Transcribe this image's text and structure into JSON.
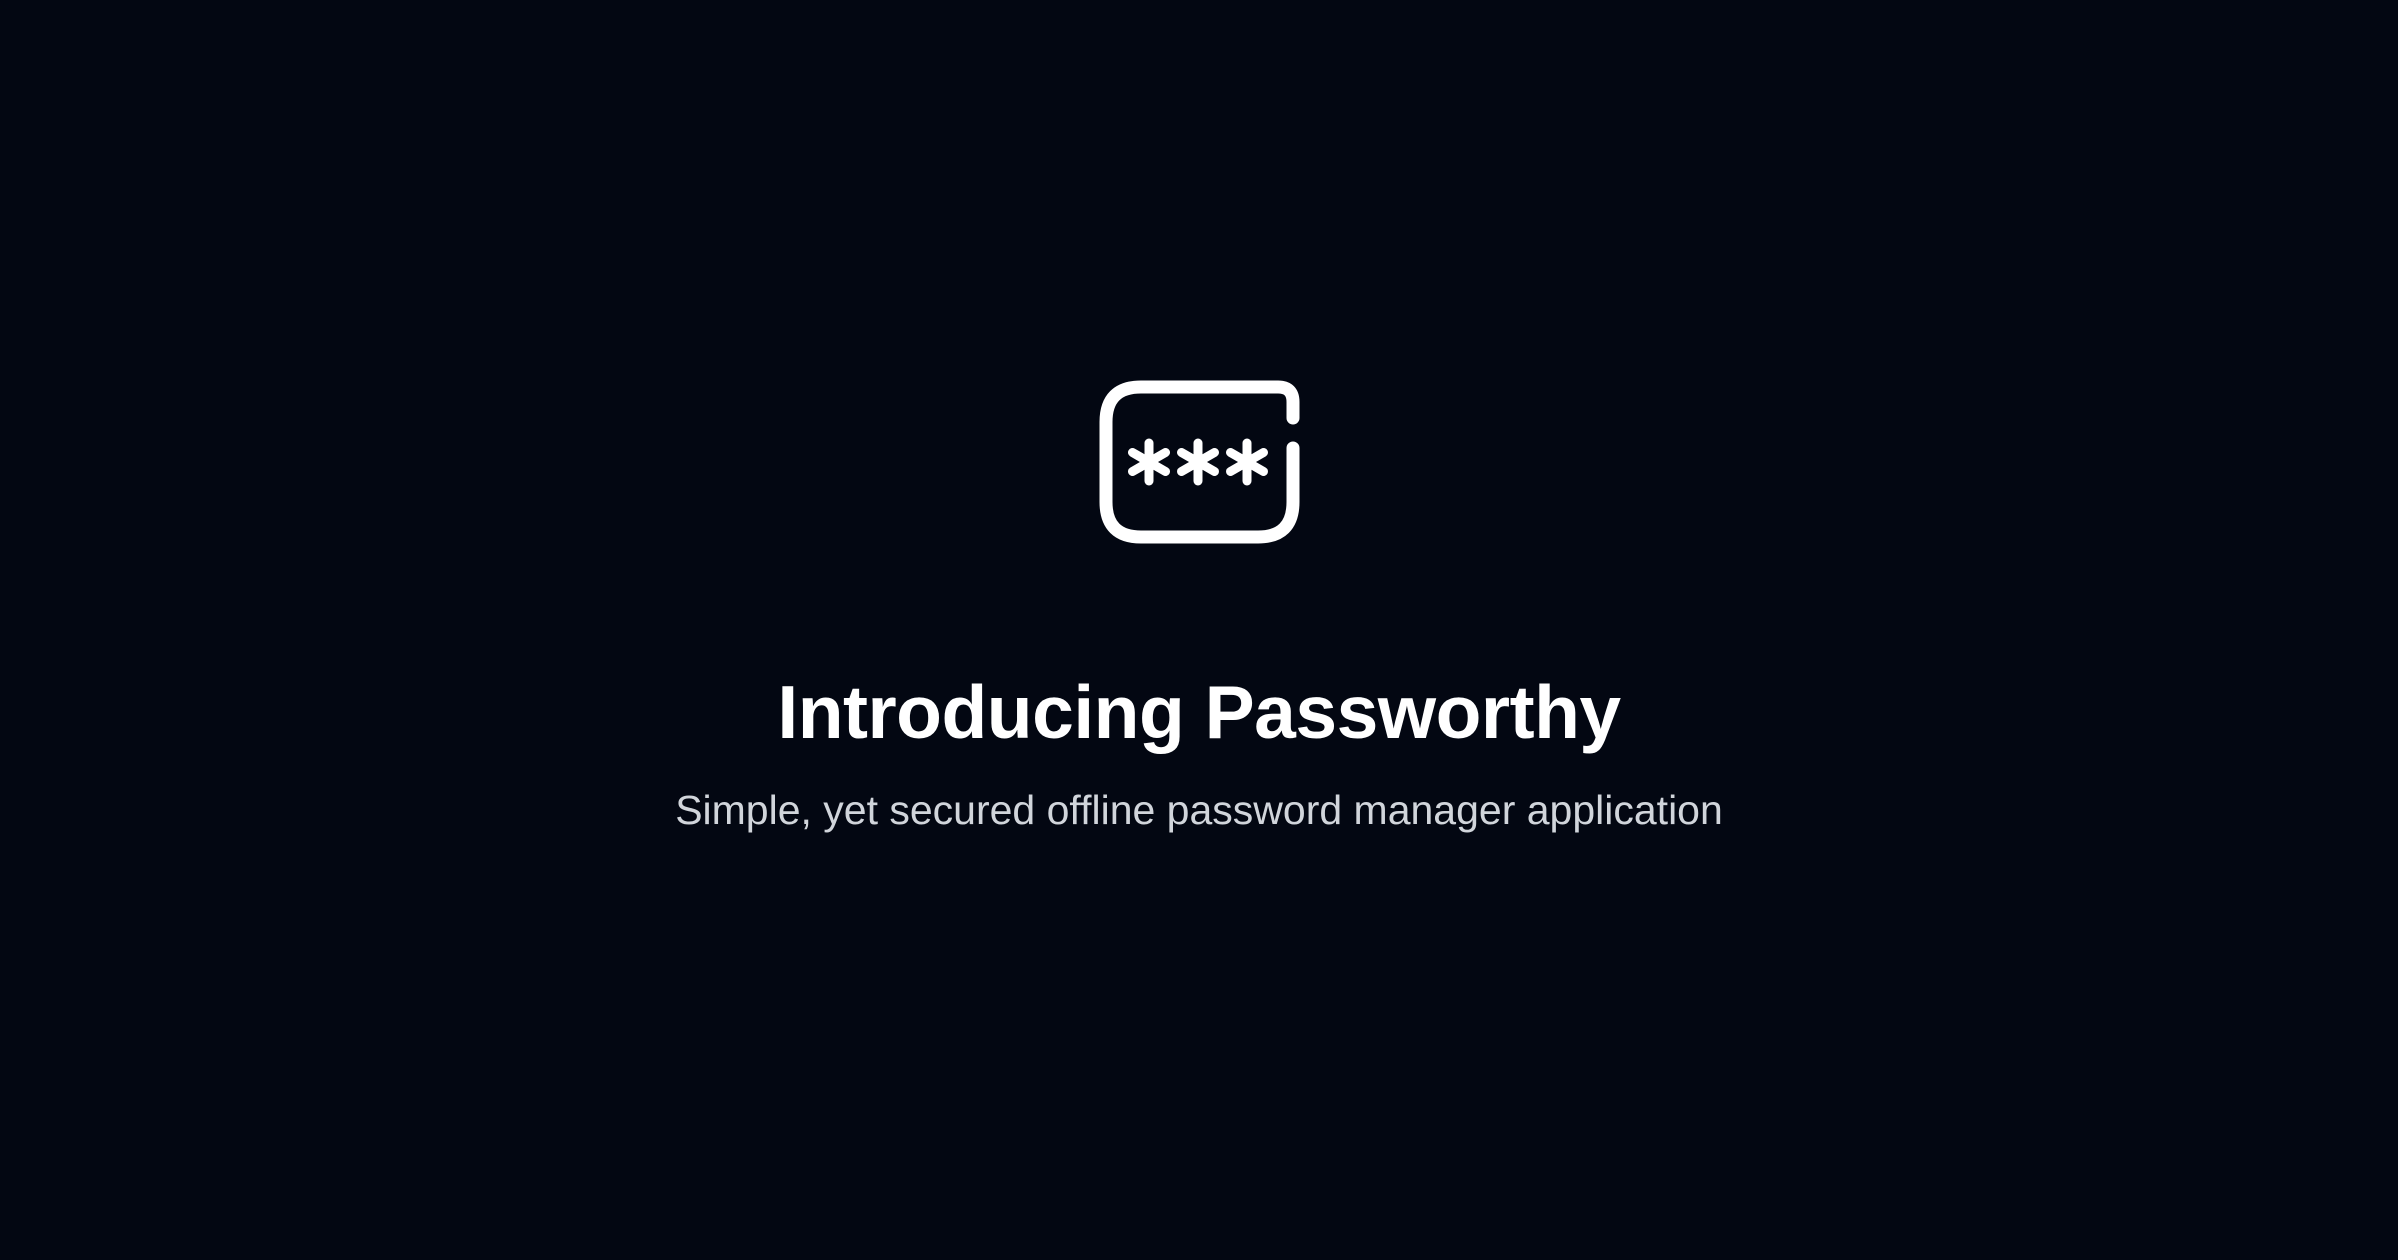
{
  "hero": {
    "logo_icon": "password-field-icon",
    "title": "Introducing Passworthy",
    "subtitle": "Simple, yet secured offline password manager application"
  },
  "colors": {
    "background": "#030712",
    "title": "#ffffff",
    "subtitle": "#d1d5db",
    "icon": "#ffffff"
  }
}
